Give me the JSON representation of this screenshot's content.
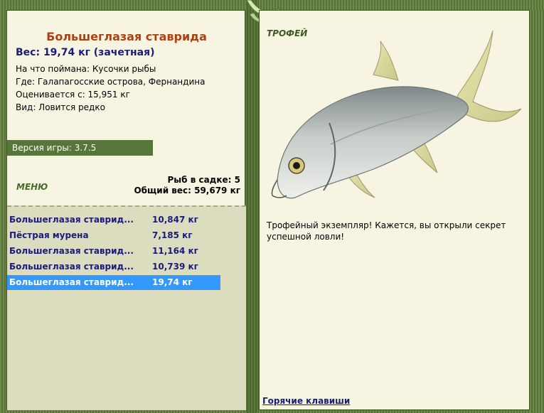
{
  "fish": {
    "title": "Большеглазая ставрида",
    "weight": "Вес: 19,74 кг (зачетная)",
    "bait": "На что поймана: Кусочки рыбы",
    "location": "Где: Галапагосские острова, Фернандина",
    "rated_from": "Оценивается с: 15,951 кг",
    "rarity": "Вид: Ловится редко"
  },
  "version": "Версия игры: 3.7.5",
  "menu_label": "МЕНЮ",
  "stats": {
    "fish_in_net": "Рыб в садке: 5",
    "total_weight": "Общий вес: 59,679 кг"
  },
  "catch_list": [
    {
      "name": "Большеглазая ставрид...",
      "weight": "10,847 кг",
      "selected": false
    },
    {
      "name": "Пёстрая мурена",
      "weight": "7,185 кг",
      "selected": false
    },
    {
      "name": "Большеглазая ставрид...",
      "weight": "11,164 кг",
      "selected": false
    },
    {
      "name": "Большеглазая ставрид...",
      "weight": "10,739 кг",
      "selected": false
    },
    {
      "name": "Большеглазая ставрид...",
      "weight": "19,74 кг",
      "selected": true
    }
  ],
  "trophy": {
    "label": "ТРОФЕЙ",
    "text": "Трофейный экземпляр! Кажется, вы открыли секрет успешной ловли!"
  },
  "hotkeys_label": "Горячие клавиши",
  "colors": {
    "frame": "#4f6b35",
    "panel": "#f7f5e2",
    "title": "#b0410e",
    "link": "#1b1b7a",
    "selection": "#3399ff"
  }
}
